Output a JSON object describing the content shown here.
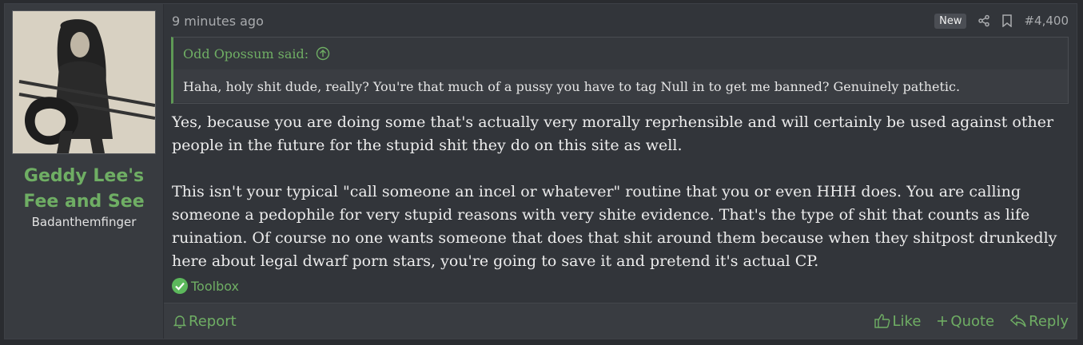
{
  "post": {
    "timestamp": "9 minutes ago",
    "badge": "New",
    "post_number": "#4,400"
  },
  "user": {
    "name": "Geddy Lee's Fee and See",
    "title": "Badanthemfinger"
  },
  "quote": {
    "author": "Odd Opossum said:",
    "text": "Haha, holy shit dude, really? You're that much of a pussy you have to tag Null in to get me banned? Genuinely pathetic."
  },
  "message": {
    "paragraph_1": "Yes, because you are doing some that's actually very morally reprhensible and will certainly be used against other people in the future for the stupid shit they do on this site as well.",
    "paragraph_2": "This isn't your typical \"call someone an incel or whatever\" routine that you or even HHH does. You are calling someone a pedophile for very stupid reasons with very shite evidence. That's the type of shit that counts as life ruination. Of course no one wants someone that does that shit around them because when they shitpost drunkedly here about legal dwarf porn stars, you're going to save it and pretend it's actual CP."
  },
  "toolbox_label": "Toolbox",
  "actions": {
    "report": "Report",
    "like": "Like",
    "quote": "Quote",
    "reply": "Reply"
  },
  "colors": {
    "accent": "#6fae64",
    "background": "#32353a",
    "sidebar": "#383b40"
  }
}
